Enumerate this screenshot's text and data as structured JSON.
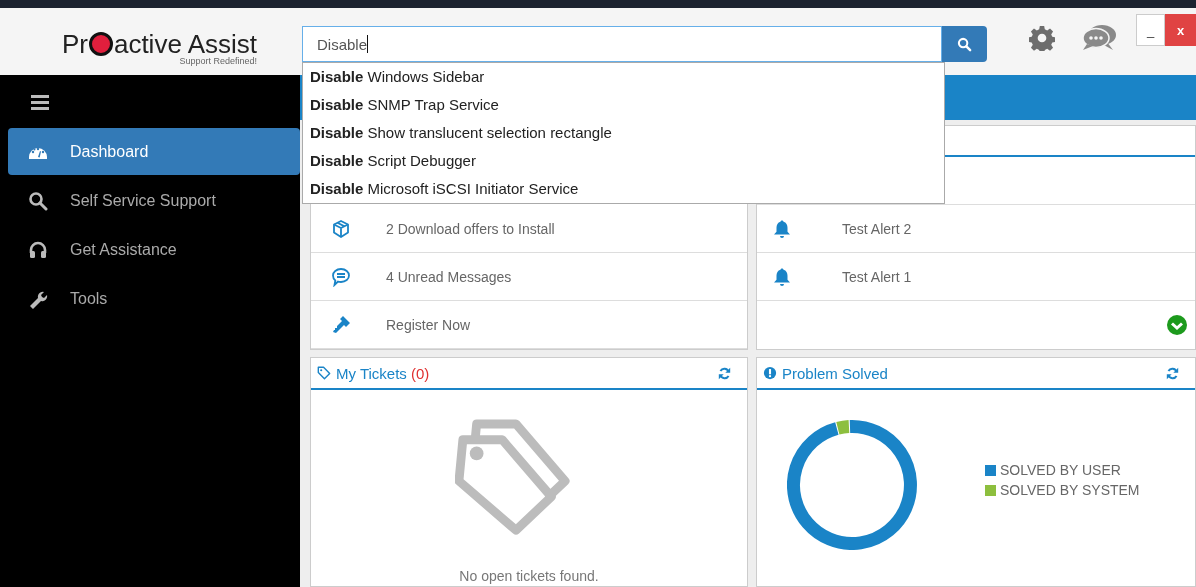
{
  "logo": {
    "name_start": "Pr",
    "name_end": "active Assist",
    "tagline": "Support Redefined!"
  },
  "search": {
    "value": "Disable",
    "suggestions": [
      "**Disable** Windows Sidebar",
      "**Disable** SNMP Trap Service",
      "**Disable** Show translucent selection rectangle",
      "**Disable** Script Debugger",
      "**Disable** Microsoft iSCSI Initiator Service"
    ]
  },
  "window_controls": {
    "minimize": "_",
    "close": "x"
  },
  "sidebar": {
    "items": [
      {
        "kind": "gauge",
        "label": "Dashboard",
        "selected": true
      },
      {
        "kind": "search",
        "label": "Self Service Support",
        "selected": false
      },
      {
        "kind": "headphones",
        "label": "Get Assistance",
        "selected": false
      },
      {
        "kind": "wrench",
        "label": "Tools",
        "selected": false
      }
    ]
  },
  "offers": {
    "rows": [
      {
        "kind": "package",
        "text": "2 Download offers to Install"
      },
      {
        "kind": "message",
        "text": "4 Unread Messages"
      },
      {
        "kind": "key",
        "text": "Register Now"
      }
    ]
  },
  "alerts": {
    "rows": [
      {
        "text": "Test Alert 2"
      },
      {
        "text": "Test Alert 1"
      }
    ]
  },
  "tickets": {
    "title": "My Tickets",
    "count": "(0)",
    "empty_text": "No open tickets found."
  },
  "problems": {
    "title": "Problem Solved",
    "legend": [
      {
        "label": "SOLVED BY USER",
        "color": "#1a84c7"
      },
      {
        "label": "SOLVED BY SYSTEM",
        "color": "#8dbf3e"
      }
    ]
  }
}
